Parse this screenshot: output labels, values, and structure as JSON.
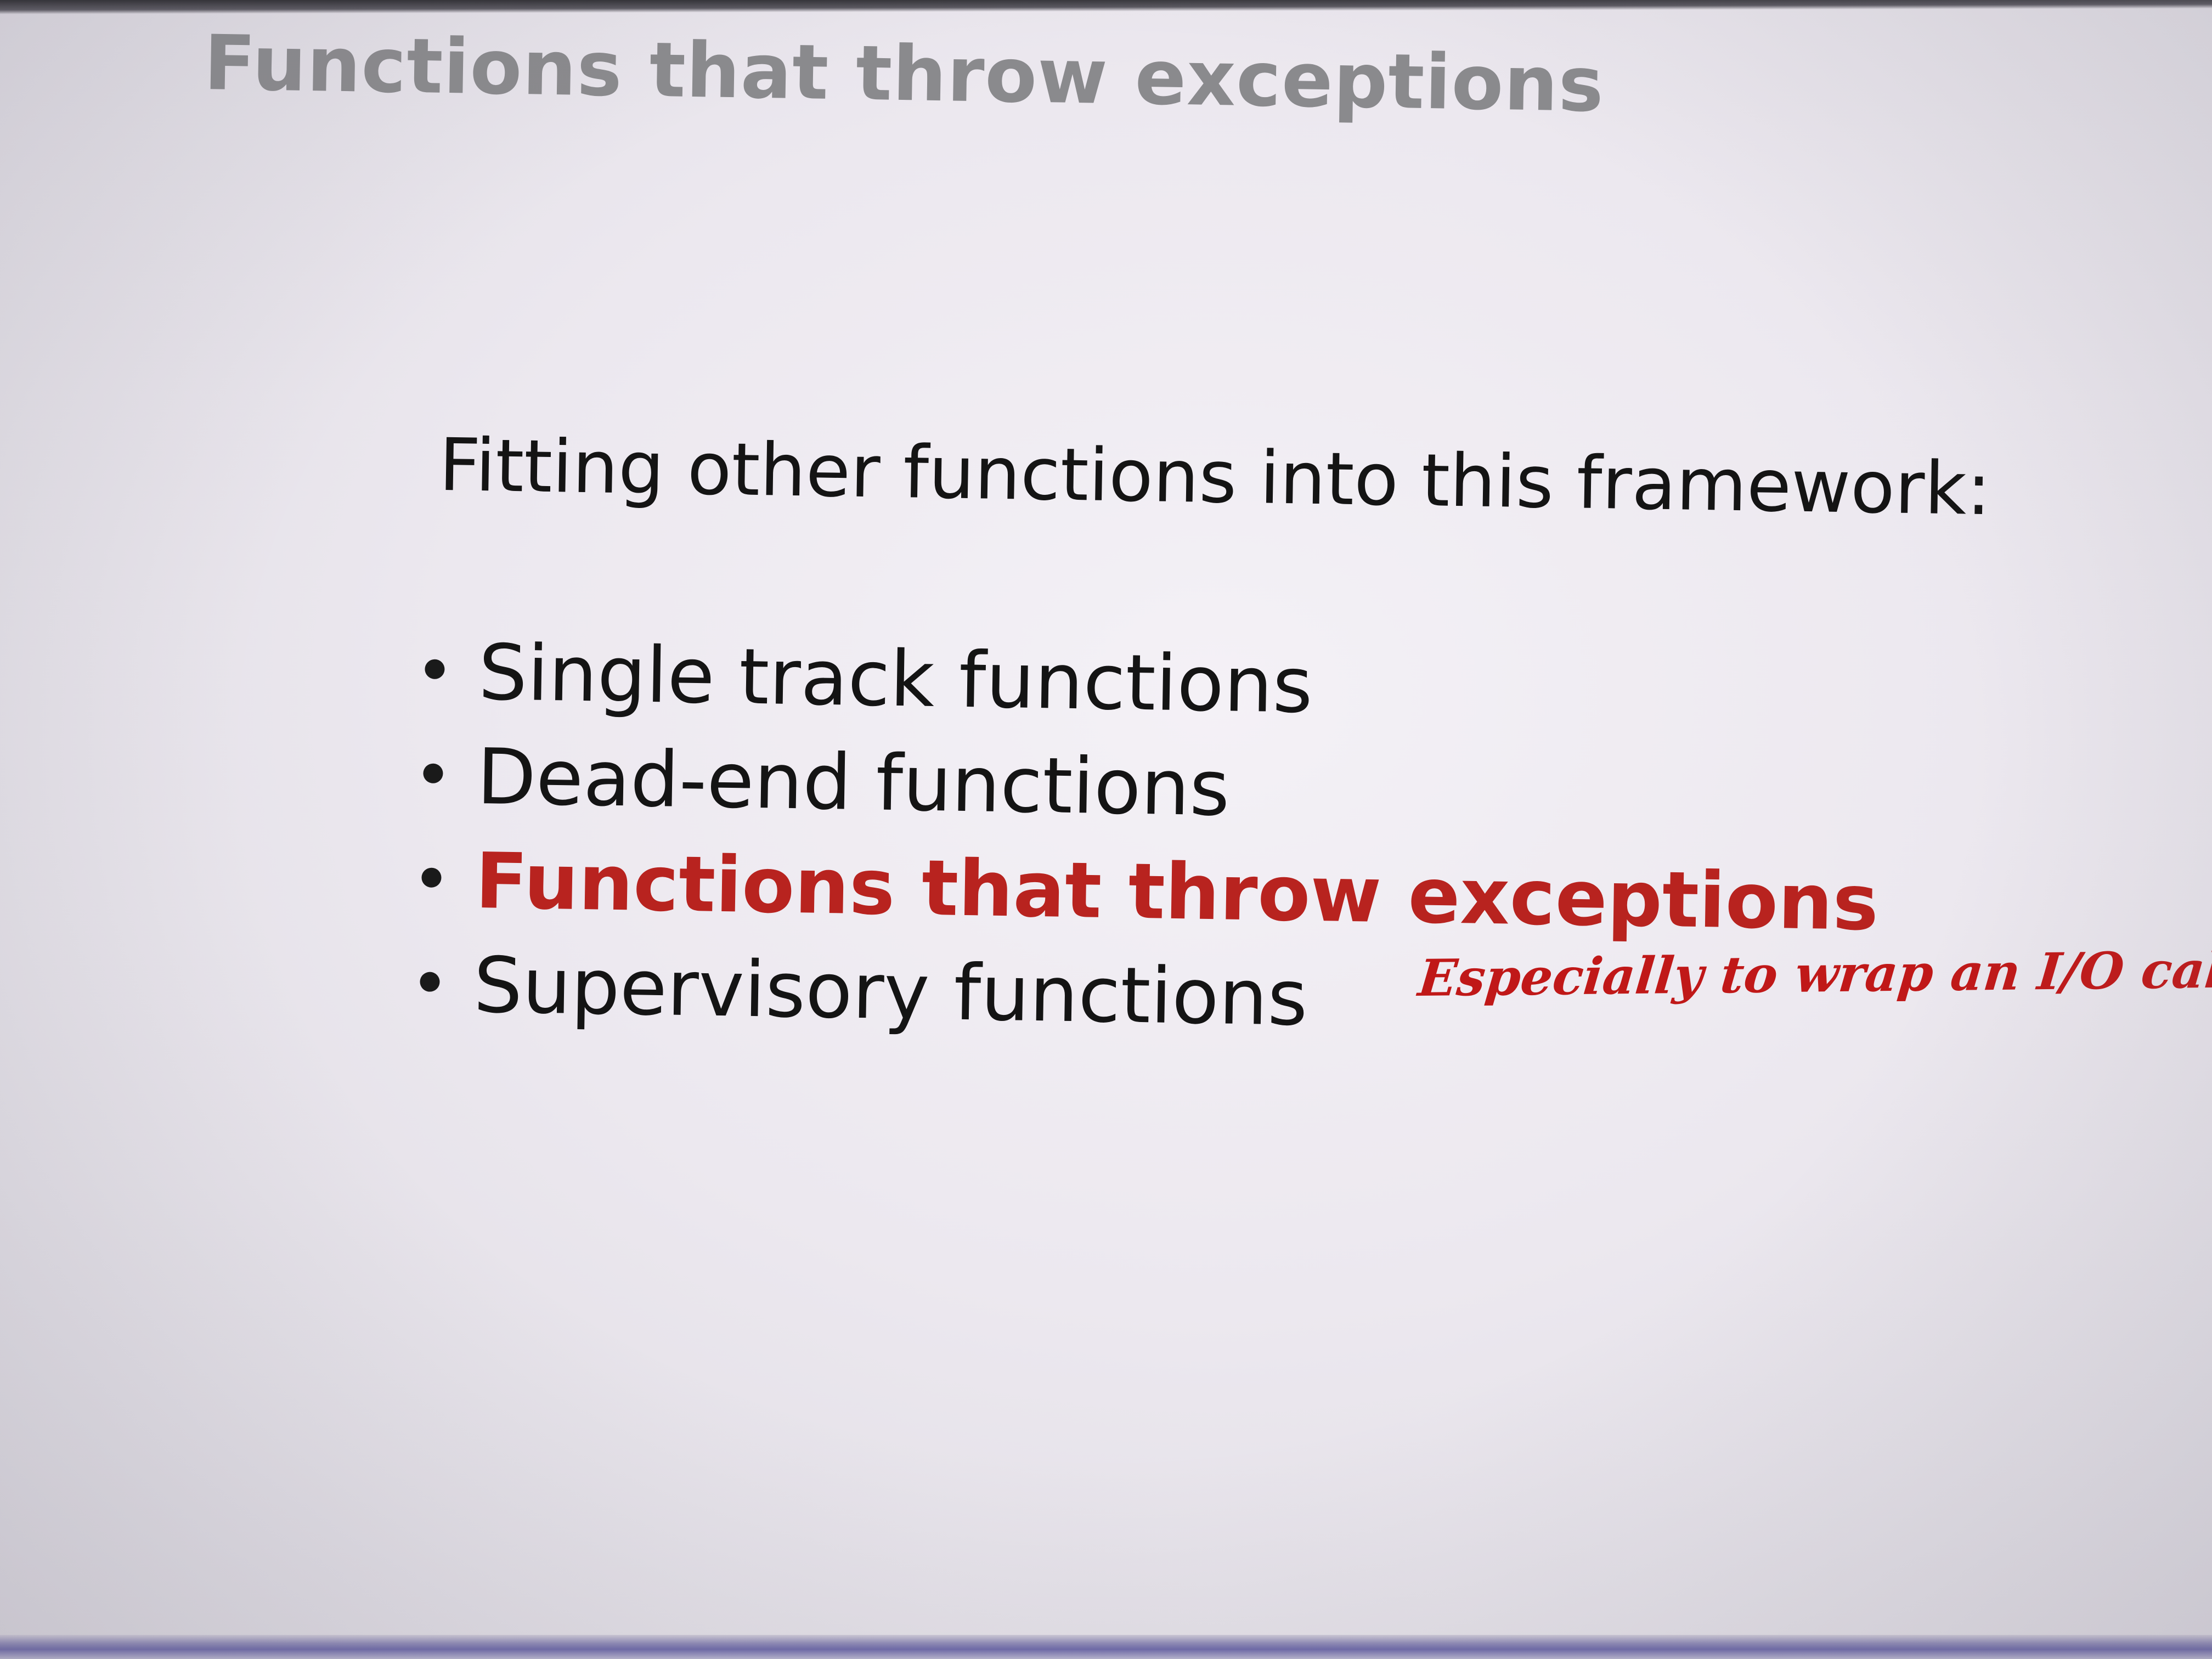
{
  "slide": {
    "title": "Functions that throw exceptions",
    "lead": "Fitting other functions into this framework:",
    "bullets": [
      {
        "text": "Single track functions"
      },
      {
        "text": "Dead-end functions"
      },
      {
        "text": "Functions that throw exceptions"
      },
      {
        "text": "Supervisory functions"
      }
    ],
    "highlighted_bullet": "Functions that throw exceptions",
    "annotation": "Especially to wrap an I/O call"
  },
  "colors": {
    "background": "#ece8ef",
    "title_gray": "#8a8a8d",
    "body_text": "#141414",
    "highlight_red": "#b8231f",
    "annotation_red": "#c01818",
    "bottom_bar": "#6d69a8"
  }
}
